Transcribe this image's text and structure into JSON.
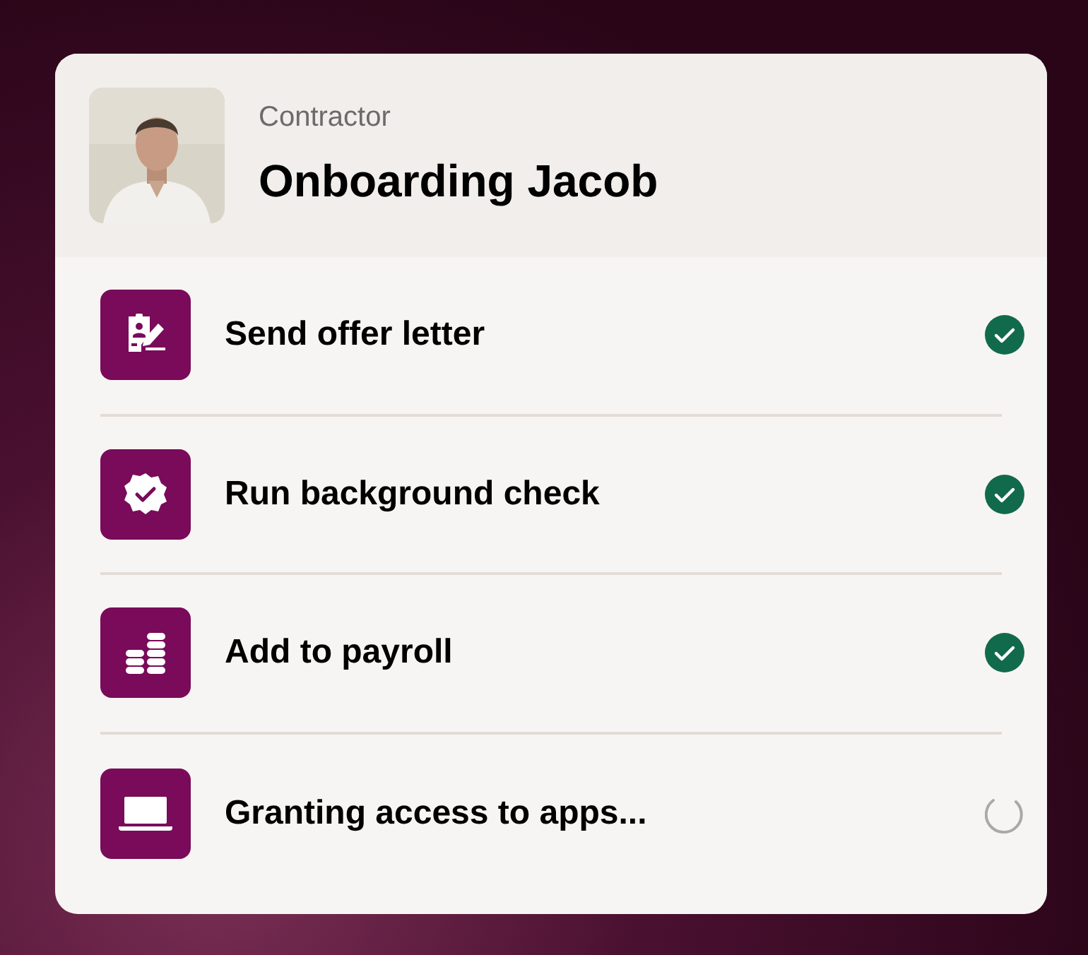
{
  "header": {
    "subtitle": "Contractor",
    "title": "Onboarding Jacob"
  },
  "tasks": [
    {
      "kind": "clipboard",
      "label": "Send offer letter",
      "done": true
    },
    {
      "kind": "badge",
      "label": "Run background check",
      "done": true
    },
    {
      "kind": "coins",
      "label": "Add to payroll",
      "done": true
    },
    {
      "kind": "laptop",
      "label": "Granting access to apps...",
      "done": false
    }
  ]
}
